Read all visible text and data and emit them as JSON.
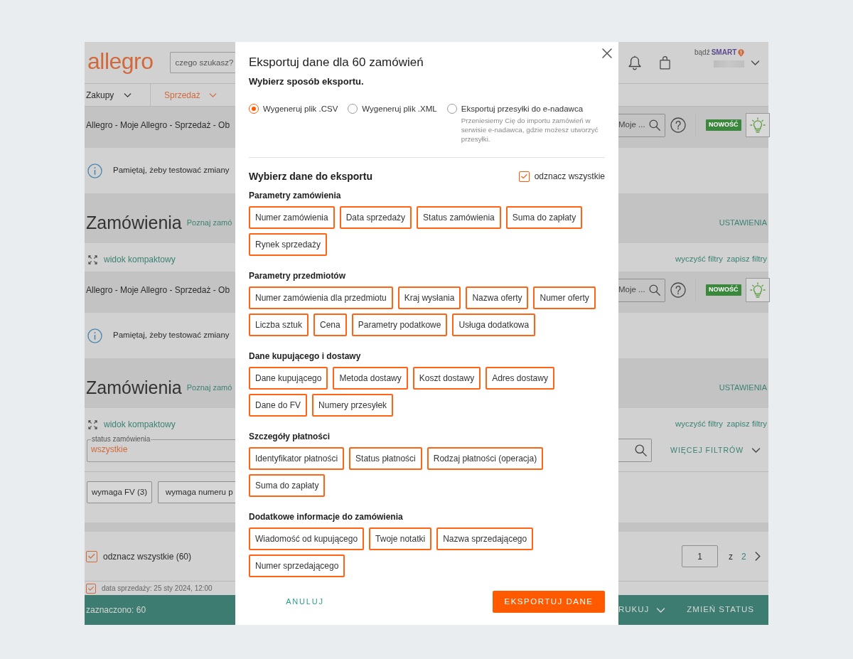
{
  "header": {
    "logo": "allegro",
    "search": {
      "placeholder": "czego szukasz?"
    },
    "promo_prefix": "bądź",
    "promo_name": "SMART"
  },
  "nav": [
    {
      "label": "Zakupy",
      "selected": false
    },
    {
      "label": "Sprzedaż",
      "selected": true
    }
  ],
  "page_blocks": [
    {
      "breadcrumb": "Allegro - Moje Allegro - Sprzedaż - Ob",
      "search": {
        "placeholder": "Moje ..."
      },
      "new_badge": "NOWOŚĆ",
      "notice": "Pamiętaj, żeby testować zmiany",
      "title": "Zamówienia",
      "title_link": "Poznaj zamó",
      "settings_link": "USTAWIENIA",
      "compact_view": "widok kompaktowy",
      "clear_filters": "wyczyść filtry",
      "save_filters": "zapisz filtry"
    },
    {
      "breadcrumb": "Allegro - Moje Allegro - Sprzedaż - Ob",
      "search": {
        "placeholder": "Moje ..."
      },
      "new_badge": "NOWOŚĆ",
      "notice": "Pamiętaj, żeby testować zmiany",
      "title": "Zamówienia",
      "title_link": "Poznaj zamó",
      "settings_link": "USTAWIENIA",
      "compact_view": "widok kompaktowy",
      "clear_filters": "wyczyść filtry",
      "save_filters": "zapisz filtry",
      "filters": {
        "status": {
          "label": "status zamówienia",
          "value": "wszystkie"
        },
        "more_filters": "WIĘCEJ FILTRÓW",
        "quick_filters": [
          "wymaga FV (3)",
          "wymaga numeru p"
        ]
      }
    }
  ],
  "order_list": {
    "select_all": {
      "label": "odznacz wszystkie (60)",
      "checked": true
    },
    "pagination": {
      "page": "1",
      "of": "z",
      "total": "2"
    },
    "rows": [
      {
        "checked": true,
        "summary": "data sprzedaży: 25 sty 2024, 12:00"
      }
    ]
  },
  "action_bar": {
    "selected_count": "zaznaczono: 60",
    "actions": [
      {
        "label": "RUKUJ",
        "kind": "menu"
      },
      {
        "label": "ZMIEŃ STATUS",
        "kind": "plain"
      }
    ]
  },
  "modal": {
    "title": "Eksportuj dane dla 60 zamówień",
    "subtitle": "Wybierz sposób eksportu.",
    "export_methods": [
      {
        "label": "Wygeneruj plik .CSV",
        "selected": true
      },
      {
        "label": "Wygeneruj plik .XML",
        "selected": false
      },
      {
        "label": "Eksportuj przesyłki do e-nadawca",
        "selected": false,
        "hint": "Przeniesiemy Cię do importu zamówień w serwisie e-nadawca, gdzie możesz utworzyć przesyłki."
      }
    ],
    "data_heading": "Wybierz dane do eksportu",
    "select_all": {
      "label": "odznacz wszystkie",
      "checked": true
    },
    "groups": [
      {
        "title": "Parametry zamówienia",
        "fields": [
          {
            "label": "Numer zamówienia",
            "selected": true
          },
          {
            "label": "Data sprzedaży",
            "selected": true
          },
          {
            "label": "Status zamówienia",
            "selected": true
          },
          {
            "label": "Suma do zapłaty",
            "selected": true
          },
          {
            "label": "Rynek sprzedaży",
            "selected": true
          }
        ]
      },
      {
        "title": "Parametry przedmiotów",
        "fields": [
          {
            "label": "Numer zamówienia dla przedmiotu",
            "selected": true
          },
          {
            "label": "Kraj wysłania",
            "selected": true
          },
          {
            "label": "Nazwa oferty",
            "selected": true
          },
          {
            "label": "Numer oferty",
            "selected": true
          },
          {
            "label": "Liczba sztuk",
            "selected": true
          },
          {
            "label": "Cena",
            "selected": true
          },
          {
            "label": "Parametry podatkowe",
            "selected": true
          },
          {
            "label": "Usługa dodatkowa",
            "selected": true
          }
        ]
      },
      {
        "title": "Dane kupującego i dostawy",
        "fields": [
          {
            "label": "Dane kupującego",
            "selected": true
          },
          {
            "label": "Metoda dostawy",
            "selected": true
          },
          {
            "label": "Koszt dostawy",
            "selected": true
          },
          {
            "label": "Adres dostawy",
            "selected": true
          },
          {
            "label": "Dane do FV",
            "selected": true
          },
          {
            "label": "Numery przesyłek",
            "selected": true
          }
        ]
      },
      {
        "title": "Szczegóły płatności",
        "fields": [
          {
            "label": "Identyfikator płatności",
            "selected": true
          },
          {
            "label": "Status płatności",
            "selected": true
          },
          {
            "label": "Rodzaj płatności (operacja)",
            "selected": true
          },
          {
            "label": "Suma do zapłaty",
            "selected": true
          }
        ]
      },
      {
        "title": "Dodatkowe informacje do zamówienia",
        "fields": [
          {
            "label": "Wiadomość od kupującego",
            "selected": true
          },
          {
            "label": "Twoje notatki",
            "selected": true
          },
          {
            "label": "Nazwa sprzedającego",
            "selected": true
          },
          {
            "label": "Numer sprzedającego",
            "selected": true
          }
        ]
      }
    ],
    "cancel": "ANULUJ",
    "submit": "EKSPORTUJ DANE"
  }
}
